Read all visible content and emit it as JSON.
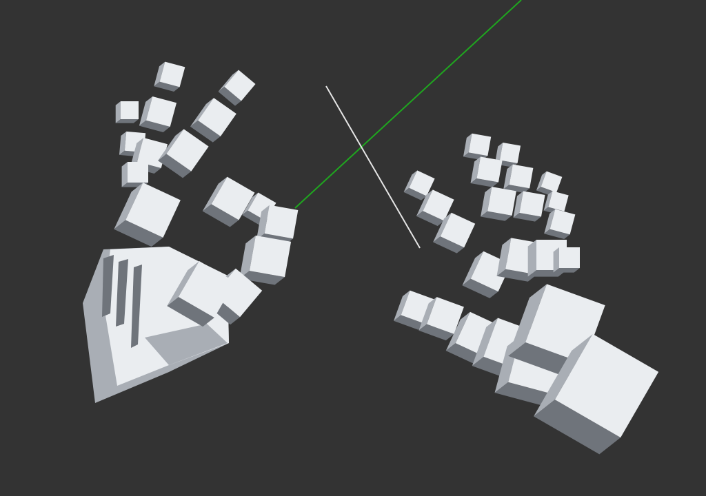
{
  "scene": {
    "background_color": "#333333",
    "cube_face_color": "#eaedf0",
    "cube_side_color": "#a9aeb5",
    "cube_dark_color": "#6f747b",
    "pointer_ray_color": "#1fa71f",
    "guide_line_color": "#e6e6e6"
  }
}
